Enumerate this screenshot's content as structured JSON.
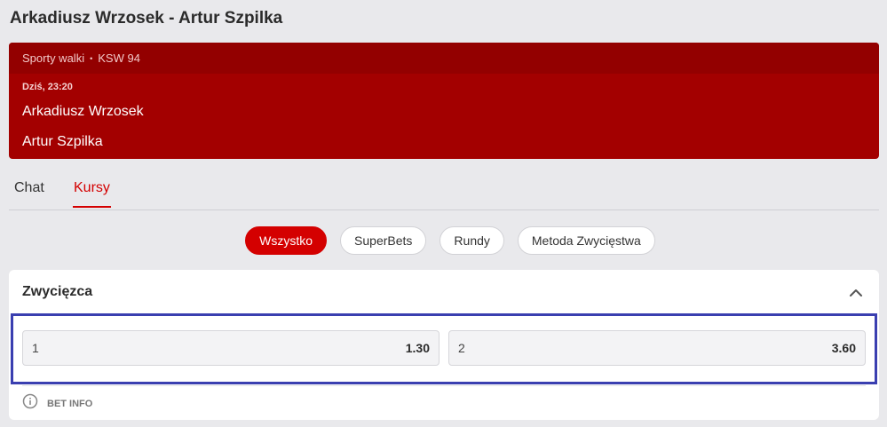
{
  "page": {
    "title": "Arkadiusz Wrzosek - Artur Szpilka"
  },
  "event": {
    "sport": "Sporty walki",
    "separator": "•",
    "league": "KSW 94",
    "time": "Dziś, 23:20",
    "team1": "Arkadiusz Wrzosek",
    "team2": "Artur Szpilka"
  },
  "tabs": [
    {
      "label": "Chat",
      "active": false
    },
    {
      "label": "Kursy",
      "active": true
    }
  ],
  "filters": [
    {
      "label": "Wszystko",
      "active": true
    },
    {
      "label": "SuperBets",
      "active": false
    },
    {
      "label": "Rundy",
      "active": false
    },
    {
      "label": "Metoda Zwycięstwa",
      "active": false
    }
  ],
  "market": {
    "title": "Zwycięzca",
    "collapse_icon": "chevron-up-icon",
    "odds": [
      {
        "label": "1",
        "price": "1.30"
      },
      {
        "label": "2",
        "price": "3.60"
      }
    ],
    "bet_info_label": "BET INFO",
    "bet_info_icon": "info-circle-icon"
  },
  "colors": {
    "accent": "#d40000",
    "event_card": "#a30000",
    "highlight_border": "#3a3fb0"
  }
}
